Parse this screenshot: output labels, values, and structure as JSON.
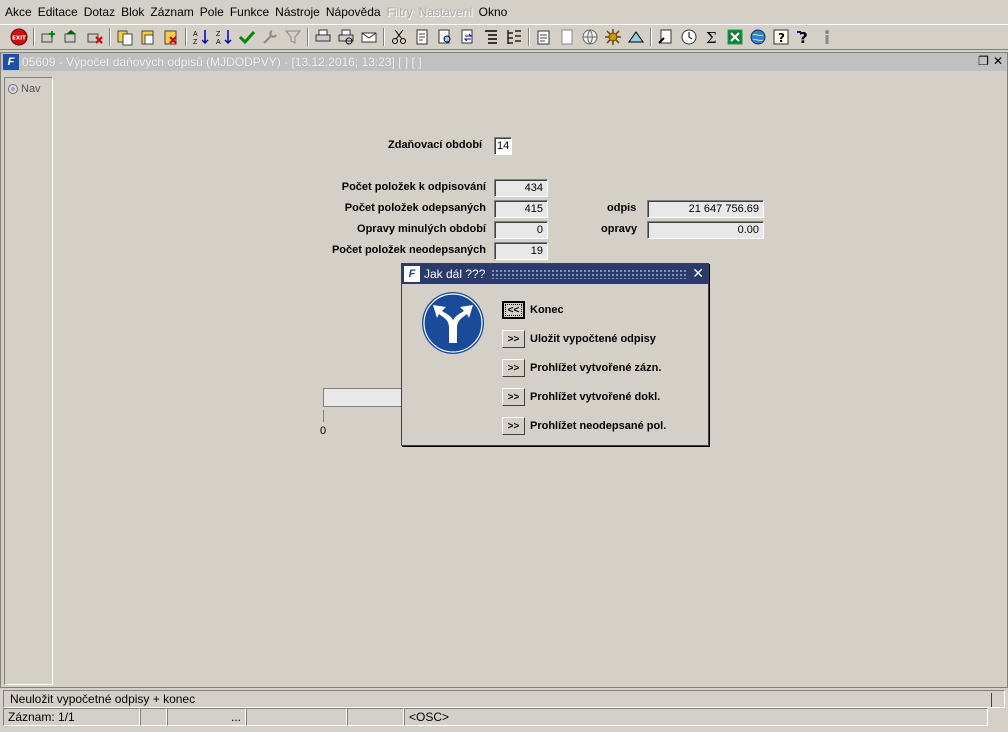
{
  "menu": {
    "items": [
      "Akce",
      "Editace",
      "Dotaz",
      "Blok",
      "Záznam",
      "Pole",
      "Funkce",
      "Nástroje",
      "Nápověda",
      "Filtry",
      "Nastavení",
      "Okno"
    ],
    "disabled": [
      "Filtry",
      "Nastavení"
    ]
  },
  "toolbar": {
    "icons": [
      "exit-icon",
      "sep",
      "insert-record-icon",
      "duplicate-record-icon",
      "delete-record-icon",
      "sep",
      "copy-icon",
      "paste-icon",
      "clear-icon",
      "sep",
      "sort-asc-icon",
      "sort-desc-icon",
      "commit-icon",
      "tools-icon",
      "filter-icon",
      "sep",
      "print-icon",
      "print-preview-icon",
      "mail-icon",
      "sep",
      "cut-icon",
      "edit-icon",
      "find-icon",
      "replace-icon",
      "list-icon",
      "tree-icon",
      "sep",
      "document-icon",
      "attachment-icon",
      "globe-icon",
      "settings-icon",
      "chart-icon",
      "sep",
      "report-icon",
      "clock-icon",
      "sum-icon",
      "excel-icon",
      "help-globe-icon",
      "question-icon",
      "context-help-icon",
      "info-icon"
    ]
  },
  "window": {
    "title": "05609 - Výpočet daňových odpisů (MJDODPVY) - [13.12.2016; 13:23]  [ ]  [ ]",
    "nav_label": "Nav"
  },
  "form": {
    "period_label": "Zdaňovací období",
    "period_value": "14",
    "rows": [
      {
        "label": "Počet položek k odpisování",
        "value": "434"
      },
      {
        "label": "Počet položek odepsaných",
        "value": "415"
      },
      {
        "label": "Opravy minulých období",
        "value": "0"
      },
      {
        "label": "Počet položek neodepsaných",
        "value": "19"
      }
    ],
    "odpis_label": "odpis",
    "odpis_value": "21 647 756.69",
    "opravy_label": "opravy",
    "opravy_value": "0.00",
    "progress_tick": "0"
  },
  "dialog": {
    "title": "Jak dál ???",
    "close": "✕",
    "options": [
      {
        "button": "<<",
        "label": "Konec"
      },
      {
        "button": ">>",
        "label": "Uložit vypočtené odpisy"
      },
      {
        "button": ">>",
        "label": "Prohlížet vytvořené zázn."
      },
      {
        "button": ">>",
        "label": "Prohlížet vytvořené dokl."
      },
      {
        "button": ">>",
        "label": "Prohlížet neodepsané pol."
      }
    ]
  },
  "status": {
    "message": "Neuložit vypočetné odpisy + konec",
    "record": "Záznam: 1/1",
    "cell3": "...",
    "mode": "<OSC>"
  },
  "colors": {
    "dialog_title_bg": "#2a3a6a",
    "sign_blue": "#1a4a9a"
  }
}
